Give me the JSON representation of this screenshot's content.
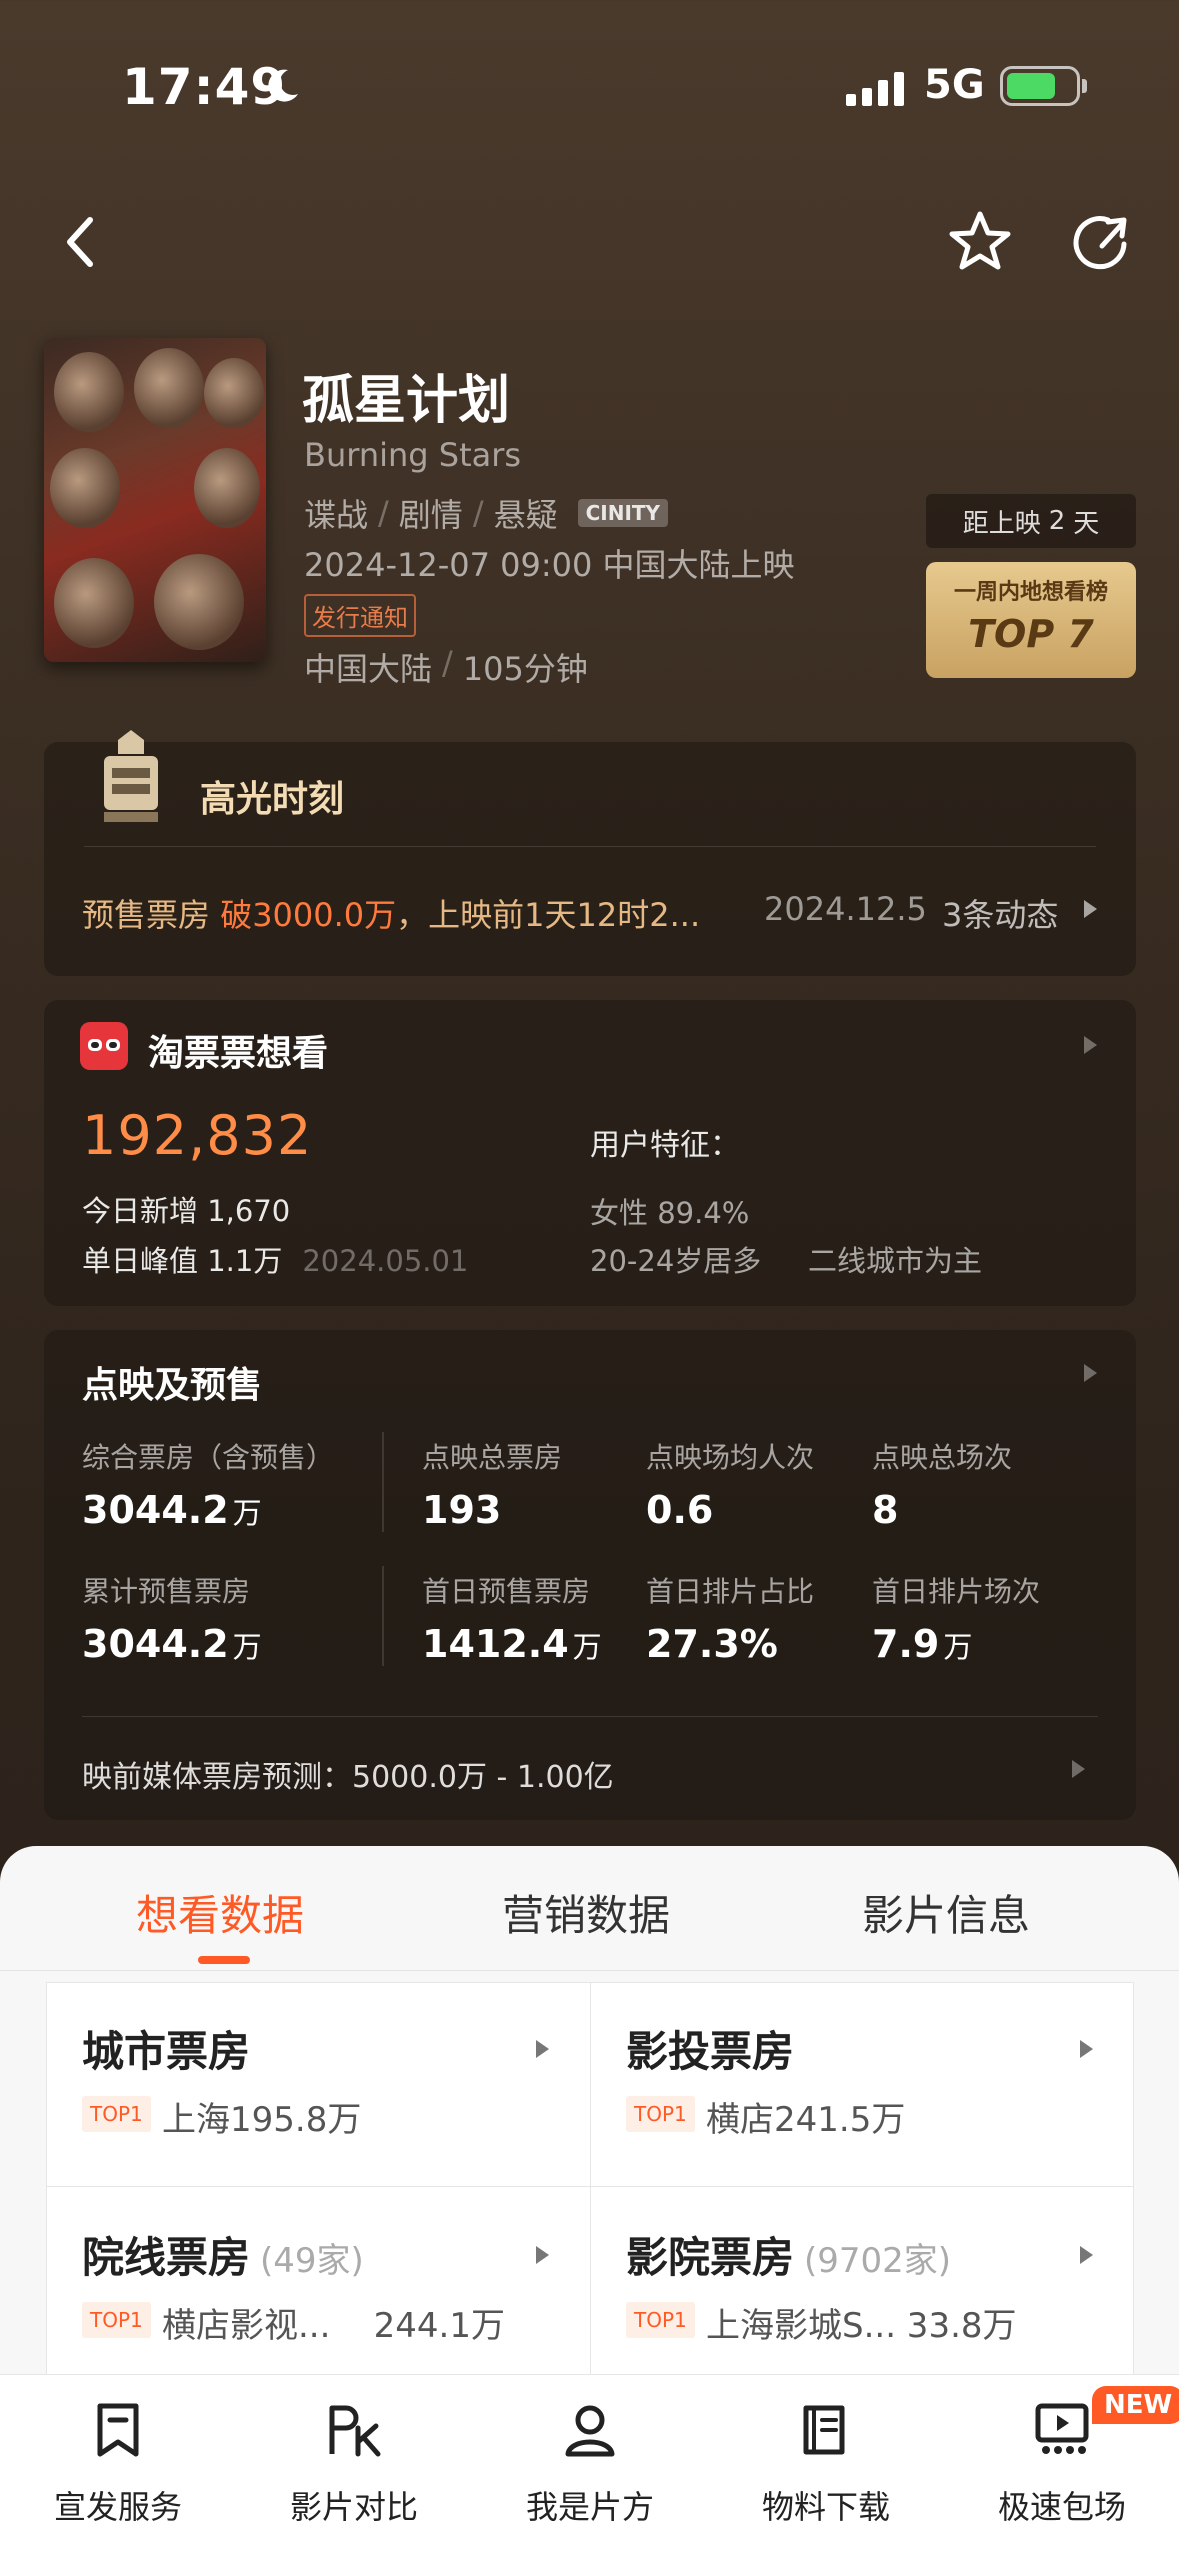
{
  "status_bar": {
    "time": "17:49",
    "network": "5G"
  },
  "movie": {
    "title": "孤星计划",
    "english_title": "Burning Stars",
    "genres": [
      "谍战",
      "剧情",
      "悬疑"
    ],
    "format_badge": "CINITY",
    "release": "2024-12-07 09:00 中国大陆上映",
    "notice_tag": "发行通知",
    "region": "中国大陆",
    "duration": "105分钟",
    "countdown_prefix": "距上映",
    "countdown_days": "2",
    "countdown_unit": "天",
    "rank_label": "一周内地想看榜",
    "rank_value": "TOP 7"
  },
  "highlight": {
    "title": "高光时刻",
    "text_prefix": "预售票房 ",
    "text_highlight": "破3000.0万",
    "text_suffix": "，上映前1天12时2...",
    "date": "2024.12.5",
    "count": "3条动态"
  },
  "want": {
    "title": "淘票票想看",
    "total": "192,832",
    "today": "今日新增 1,670",
    "peak": "单日峰值 1.1万",
    "peak_date": "2024.05.01",
    "feature_label": "用户特征：",
    "feature_gender": "女性 89.4%",
    "feature_age": "20-24岁居多",
    "feature_city": "二线城市为主"
  },
  "presale": {
    "title": "点映及预售",
    "stats": [
      {
        "label": "综合票房（含预售）",
        "value": "3044.2",
        "unit": "万"
      },
      {
        "label": "点映总票房",
        "value": "193",
        "unit": ""
      },
      {
        "label": "点映场均人次",
        "value": "0.6",
        "unit": ""
      },
      {
        "label": "点映总场次",
        "value": "8",
        "unit": ""
      },
      {
        "label": "累计预售票房",
        "value": "3044.2",
        "unit": "万"
      },
      {
        "label": "首日预售票房",
        "value": "1412.4",
        "unit": "万"
      },
      {
        "label": "首日排片占比",
        "value": "27.3%",
        "unit": ""
      },
      {
        "label": "首日排片场次",
        "value": "7.9",
        "unit": "万"
      }
    ],
    "forecast": "映前媒体票房预测：5000.0万 - 1.00亿"
  },
  "tabs": [
    "想看数据",
    "营销数据",
    "影片信息"
  ],
  "box_office": [
    {
      "title": "城市票房",
      "count": "",
      "top": "TOP1",
      "info": "上海195.8万"
    },
    {
      "title": "影投票房",
      "count": "",
      "top": "TOP1",
      "info": "横店241.5万"
    },
    {
      "title": "院线票房",
      "count": "(49家)",
      "top": "TOP1",
      "info": "横店影视...    244.1万"
    },
    {
      "title": "影院票房",
      "count": "(9702家)",
      "top": "TOP1",
      "info": "上海影城S... 33.8万"
    }
  ],
  "bottom_nav": [
    {
      "label": "宣发服务",
      "icon": "bookmark-icon"
    },
    {
      "label": "影片对比",
      "icon": "pk-icon"
    },
    {
      "label": "我是片方",
      "icon": "user-icon"
    },
    {
      "label": "物料下载",
      "icon": "book-icon"
    },
    {
      "label": "极速包场",
      "icon": "screen-icon"
    }
  ],
  "new_badge": "NEW",
  "colors": {
    "accent": "#ff5a25",
    "highlight": "#ff8d48",
    "gold": "#e7c98e"
  }
}
